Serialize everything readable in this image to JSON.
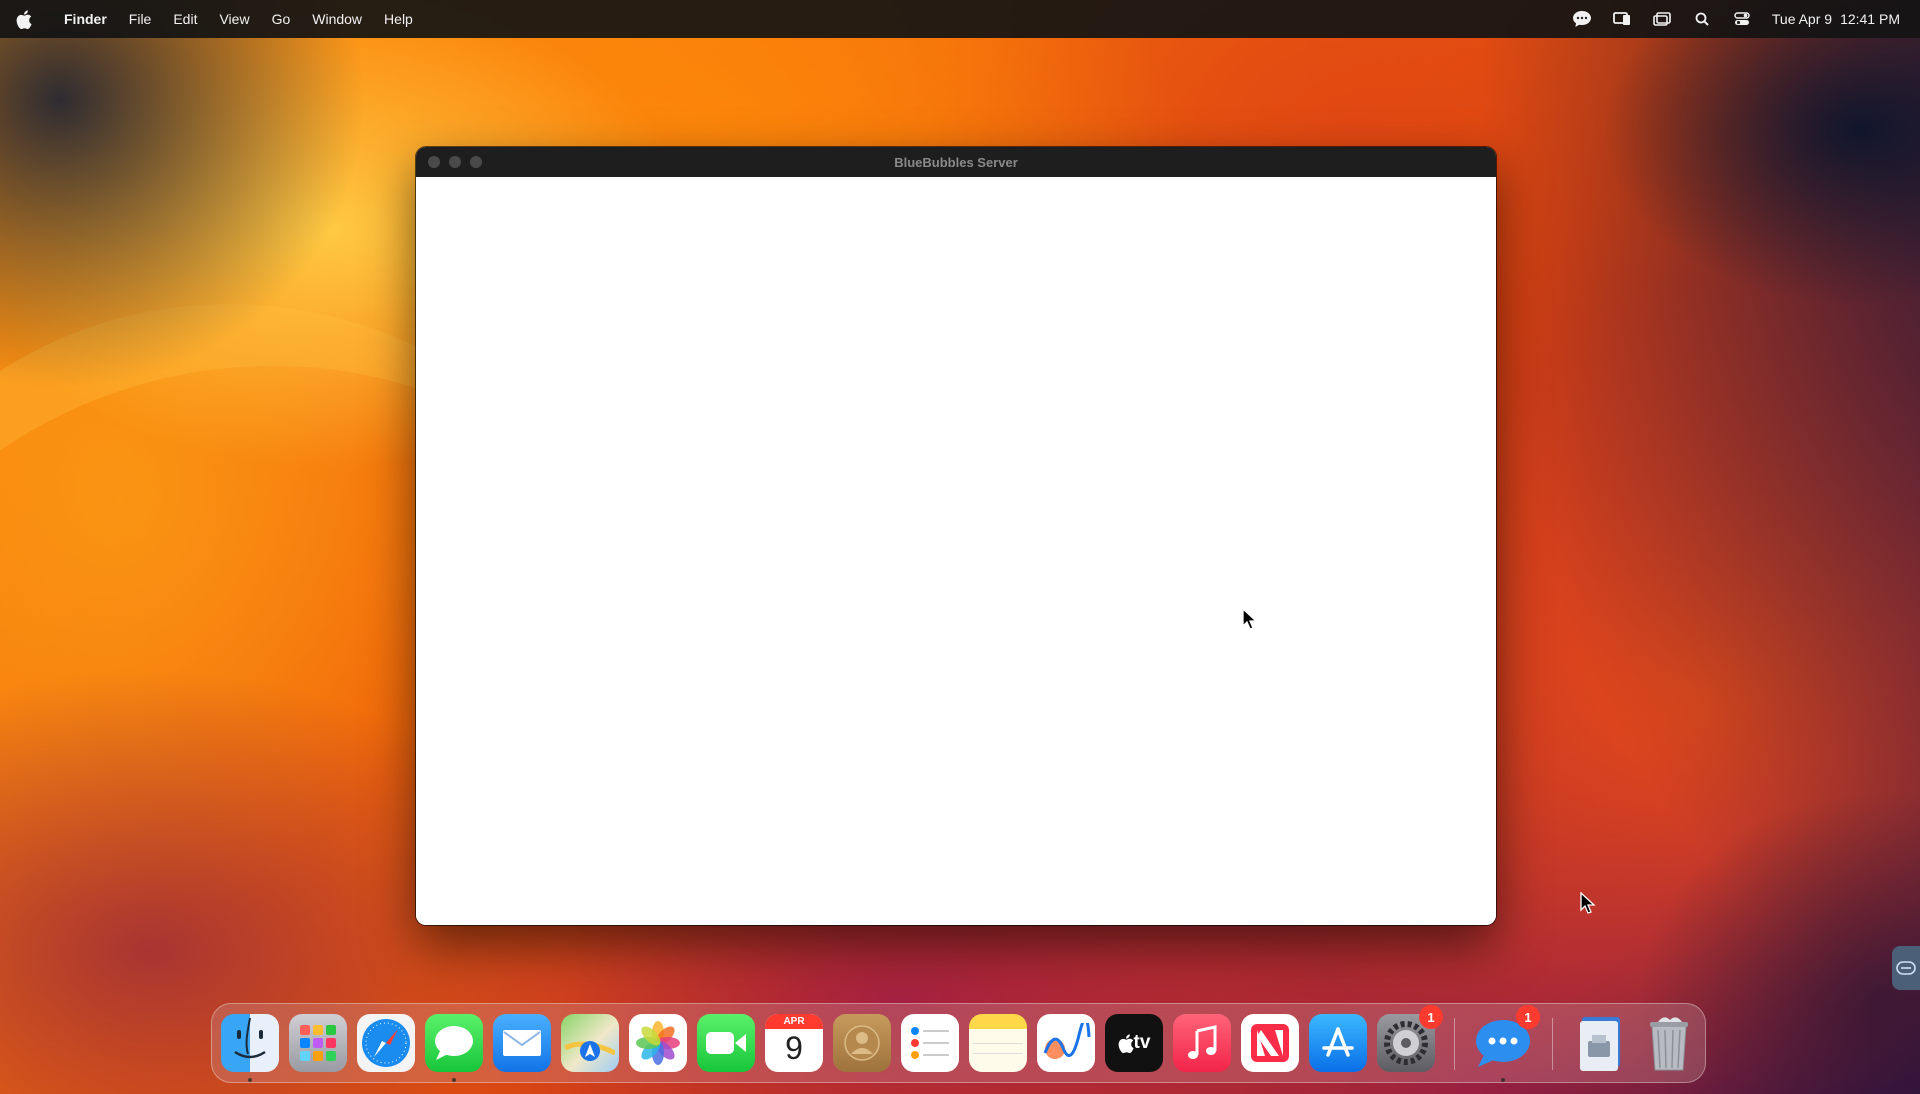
{
  "menubar": {
    "app_name": "Finder",
    "menus": [
      "File",
      "Edit",
      "View",
      "Go",
      "Window",
      "Help"
    ],
    "status_icons": [
      "messages-status-icon",
      "screen-mirroring-icon",
      "stage-manager-icon",
      "spotlight-search-icon",
      "control-center-icon"
    ],
    "clock": {
      "date": "Tue Apr 9",
      "time": "12:41 PM"
    }
  },
  "window": {
    "title": "BlueBubbles Server"
  },
  "dock": {
    "apps": [
      {
        "name": "Finder",
        "running": true
      },
      {
        "name": "Launchpad"
      },
      {
        "name": "Safari"
      },
      {
        "name": "Messages",
        "running": true
      },
      {
        "name": "Mail"
      },
      {
        "name": "Maps"
      },
      {
        "name": "Photos"
      },
      {
        "name": "FaceTime"
      },
      {
        "name": "Calendar",
        "month": "APR",
        "day": "9"
      },
      {
        "name": "Contacts"
      },
      {
        "name": "Reminders"
      },
      {
        "name": "Notes"
      },
      {
        "name": "Freeform"
      },
      {
        "name": "TV",
        "label": "tv"
      },
      {
        "name": "Music"
      },
      {
        "name": "News"
      },
      {
        "name": "App Store"
      },
      {
        "name": "System Settings",
        "badge": "1"
      },
      {
        "name": "BlueBubbles",
        "badge": "1",
        "running": true
      },
      {
        "name": "Downloads"
      },
      {
        "name": "Trash"
      }
    ]
  }
}
